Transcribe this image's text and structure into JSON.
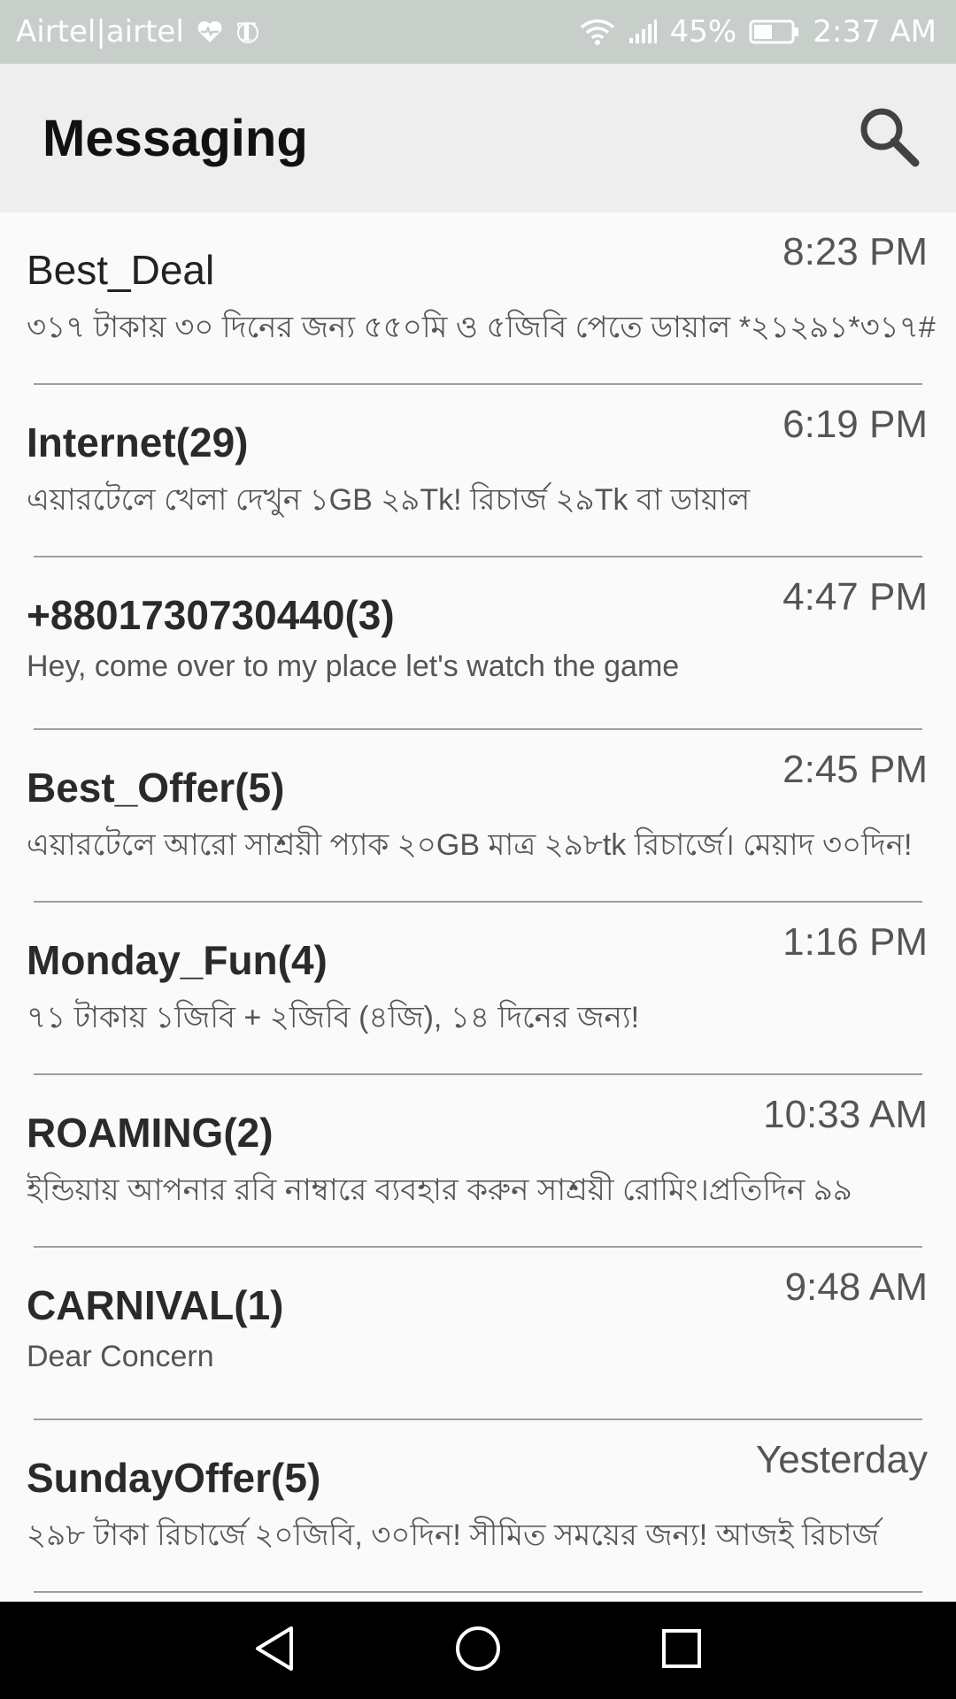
{
  "status_bar": {
    "carrier": "Airtel|airtel",
    "battery": "45%",
    "time": "2:37 AM",
    "color": "#c8cfcb"
  },
  "app_bar": {
    "title": "Messaging",
    "search_icon": "search-icon"
  },
  "conversations": [
    {
      "sender": "Best_Deal",
      "time": "8:23 PM",
      "snippet": "৩১৭ টাকায় ৩০ দিনের জন্য ৫৫০মি ও ৫জিবি পেতে ডায়াল *২১২৯১*৩১৭#",
      "unread": false
    },
    {
      "sender": "Internet(29)",
      "time": "6:19 PM",
      "snippet": "এয়ারটেলে খেলা দেখুন ১GB ২৯Tk! রিচার্জ ২৯Tk বা ডায়াল",
      "unread": true
    },
    {
      "sender": "+8801730730440(3)",
      "time": "4:47 PM",
      "snippet": "Hey, come over to my place let's watch the game",
      "unread": true
    },
    {
      "sender": "Best_Offer(5)",
      "time": "2:45 PM",
      "snippet": "এয়ারটেলে আরো সাশ্রয়ী প্যাক ২০GB মাত্র ২৯৮tk রিচার্জে। মেয়াদ ৩০দিন!",
      "unread": true
    },
    {
      "sender": "Monday_Fun(4)",
      "time": "1:16 PM",
      "snippet": "৭১ টাকায় ১জিবি + ২জিবি (৪জি), ১৪ দিনের জন্য!",
      "unread": true
    },
    {
      "sender": "ROAMING(2)",
      "time": "10:33 AM",
      "snippet": "ইন্ডিয়ায় আপনার রবি নাম্বারে ব্যবহার করুন সাশ্রয়ী রোমিং।প্রতিদিন ৯৯",
      "unread": true
    },
    {
      "sender": "CARNIVAL(1)",
      "time": "9:48 AM",
      "snippet": "Dear Concern",
      "unread": true
    },
    {
      "sender": "SundayOffer(5)",
      "time": "Yesterday",
      "snippet": "২৯৮ টাকা রিচার্জে ২০জিবি, ৩০দিন! সীমিত সময়ের জন্য! আজই রিচার্জ",
      "unread": true
    }
  ],
  "nav_bar": {
    "back_icon": "back-triangle-icon",
    "home_icon": "home-circle-icon",
    "recents_icon": "recents-square-icon"
  }
}
